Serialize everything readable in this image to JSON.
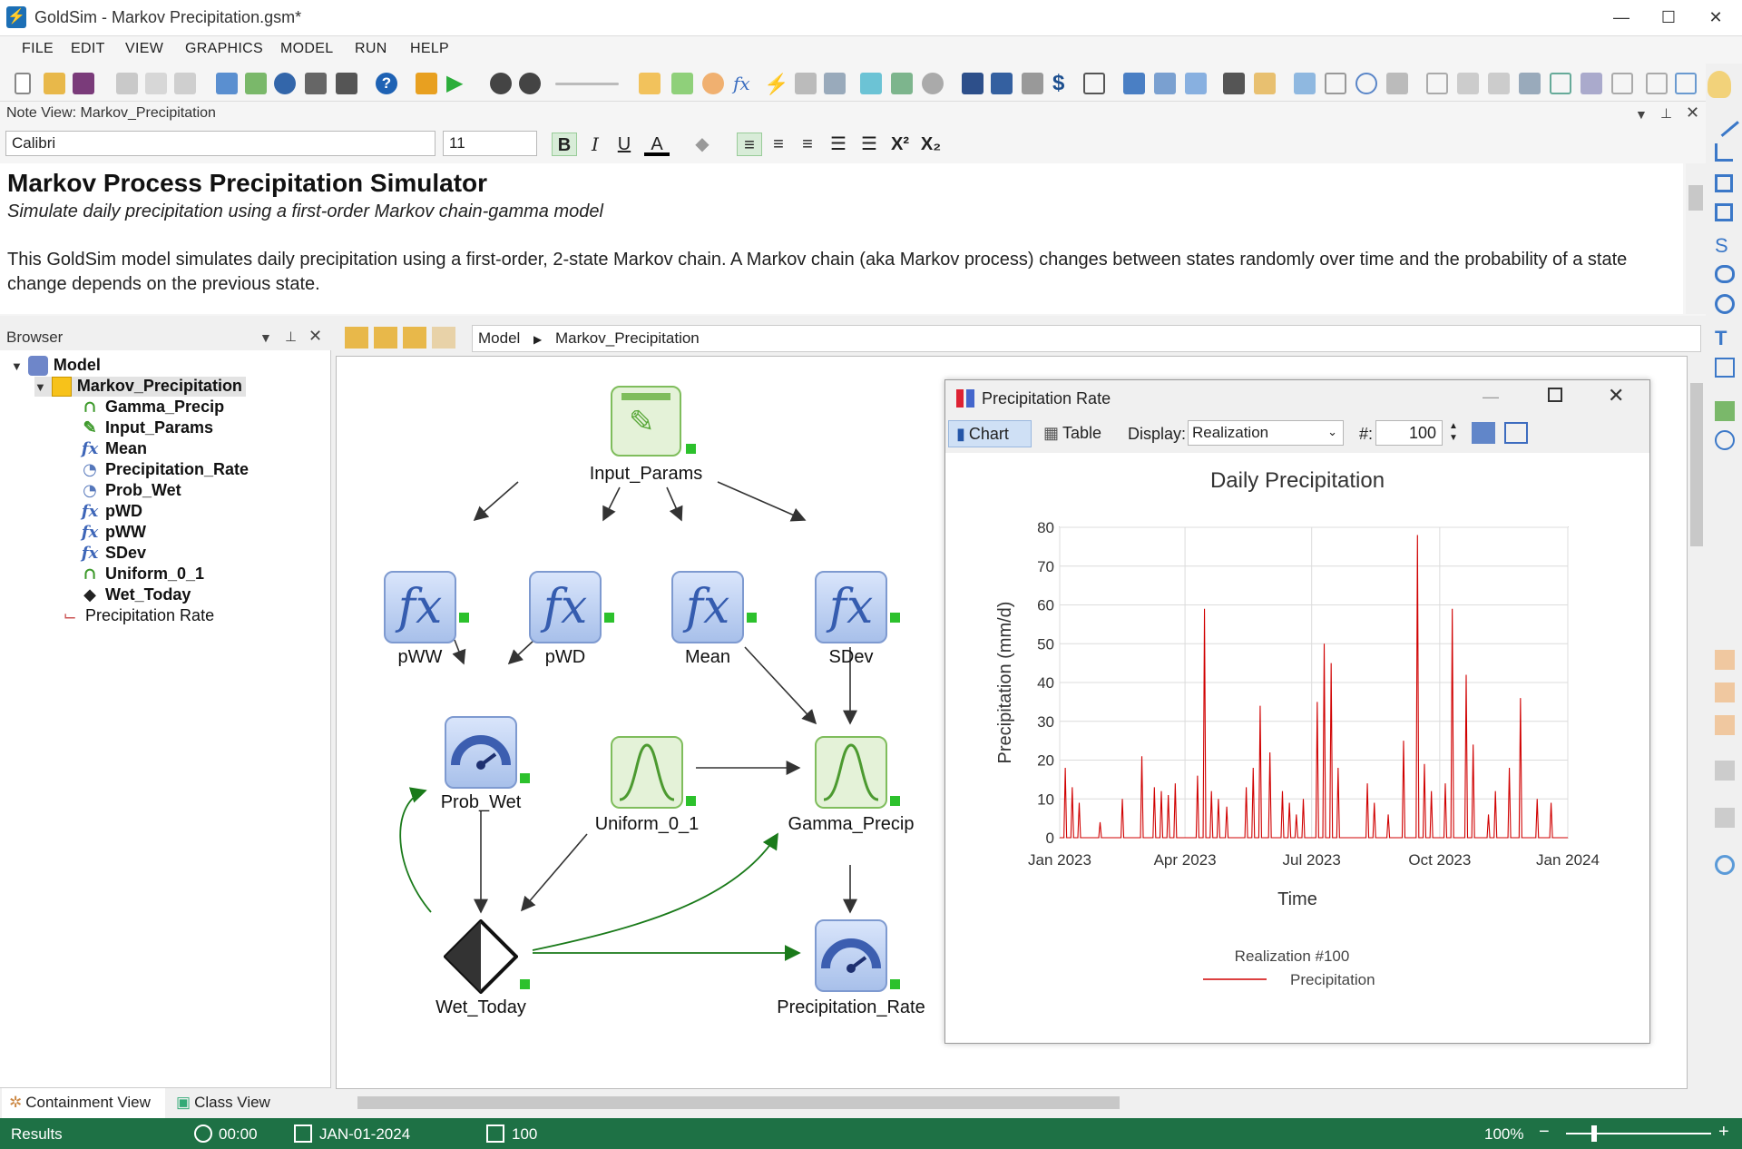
{
  "window": {
    "title": "GoldSim  - Markov Precipitation.gsm*",
    "min": "—",
    "max": "☐",
    "close": "✕"
  },
  "menu": [
    "FILE",
    "EDIT",
    "VIEW",
    "GRAPHICS",
    "MODEL",
    "RUN",
    "HELP"
  ],
  "note_view": {
    "header": "Note View: Markov_Precipitation",
    "font": "Calibri",
    "size": "11",
    "heading": "Markov Process Precipitation Simulator",
    "subheading": "Simulate daily precipitation using a first-order Markov chain-gamma model",
    "paragraph": "This GoldSim model simulates daily precipitation using a first-order, 2-state Markov chain. A Markov chain (aka Markov process) changes between states randomly over time and the probability of a state change depends on the previous state."
  },
  "browser": {
    "header": "Browser",
    "root": "Model",
    "container": "Markov_Precipitation",
    "items": [
      "Gamma_Precip",
      "Input_Params",
      "Mean",
      "Precipitation_Rate",
      "Prob_Wet",
      "pWD",
      "pWW",
      "SDev",
      "Uniform_0_1",
      "Wet_Today"
    ],
    "result": "Precipitation Rate",
    "tab_containment": "Containment View",
    "tab_class": "Class View"
  },
  "breadcrumb": {
    "root": "Model",
    "current": "Markov_Precipitation"
  },
  "nodes": {
    "input_params": "Input_Params",
    "pww": "pWW",
    "pwd": "pWD",
    "mean": "Mean",
    "sdev": "SDev",
    "prob_wet": "Prob_Wet",
    "uniform": "Uniform_0_1",
    "gamma": "Gamma_Precip",
    "wet_today": "Wet_Today",
    "precip_rate": "Precipitation_Rate"
  },
  "chart_window": {
    "title": "Precipitation Rate",
    "tab_chart": "Chart",
    "tab_table": "Table",
    "display_label": "Display:",
    "display_value": "Realization",
    "num_label": "#:",
    "num_value": "100"
  },
  "chart_data": {
    "type": "line",
    "title": "Daily Precipitation",
    "xlabel": "Time",
    "ylabel": "Precipitation (mm/d)",
    "ylim": [
      0,
      80
    ],
    "yticks": [
      "0",
      "10",
      "20",
      "30",
      "40",
      "50",
      "60",
      "70",
      "80"
    ],
    "xticks": [
      "Jan 2023",
      "Apr 2023",
      "Jul 2023",
      "Oct 2023",
      "Jan 2024"
    ],
    "xlim": [
      "2023-01-01",
      "2024-01-01"
    ],
    "legend_title": "Realization #100",
    "grid": true,
    "color": "#d00000",
    "series": [
      {
        "name": "Precipitation",
        "x": [
          "2023-01-05",
          "2023-01-10",
          "2023-01-15",
          "2023-01-30",
          "2023-02-15",
          "2023-03-01",
          "2023-03-10",
          "2023-03-15",
          "2023-03-20",
          "2023-03-25",
          "2023-04-10",
          "2023-04-15",
          "2023-04-20",
          "2023-04-25",
          "2023-05-01",
          "2023-05-15",
          "2023-05-20",
          "2023-05-25",
          "2023-06-01",
          "2023-06-10",
          "2023-06-15",
          "2023-06-20",
          "2023-06-25",
          "2023-07-05",
          "2023-07-10",
          "2023-07-15",
          "2023-07-20",
          "2023-08-10",
          "2023-08-15",
          "2023-08-25",
          "2023-09-05",
          "2023-09-15",
          "2023-09-20",
          "2023-09-25",
          "2023-10-05",
          "2023-10-10",
          "2023-10-20",
          "2023-10-25",
          "2023-11-05",
          "2023-11-10",
          "2023-11-20",
          "2023-11-28",
          "2023-12-10",
          "2023-12-20"
        ],
        "y": [
          18,
          13,
          9,
          4,
          10,
          21,
          13,
          12,
          11,
          14,
          16,
          59,
          12,
          10,
          8,
          13,
          18,
          34,
          22,
          12,
          9,
          6,
          10,
          35,
          50,
          45,
          18,
          14,
          9,
          6,
          25,
          78,
          19,
          12,
          14,
          59,
          42,
          24,
          6,
          12,
          18,
          36,
          10,
          9
        ]
      }
    ]
  },
  "status": {
    "panel": "Results",
    "time": "00:00",
    "date": "JAN-01-2024",
    "realizations": "100",
    "zoom": "100%"
  }
}
